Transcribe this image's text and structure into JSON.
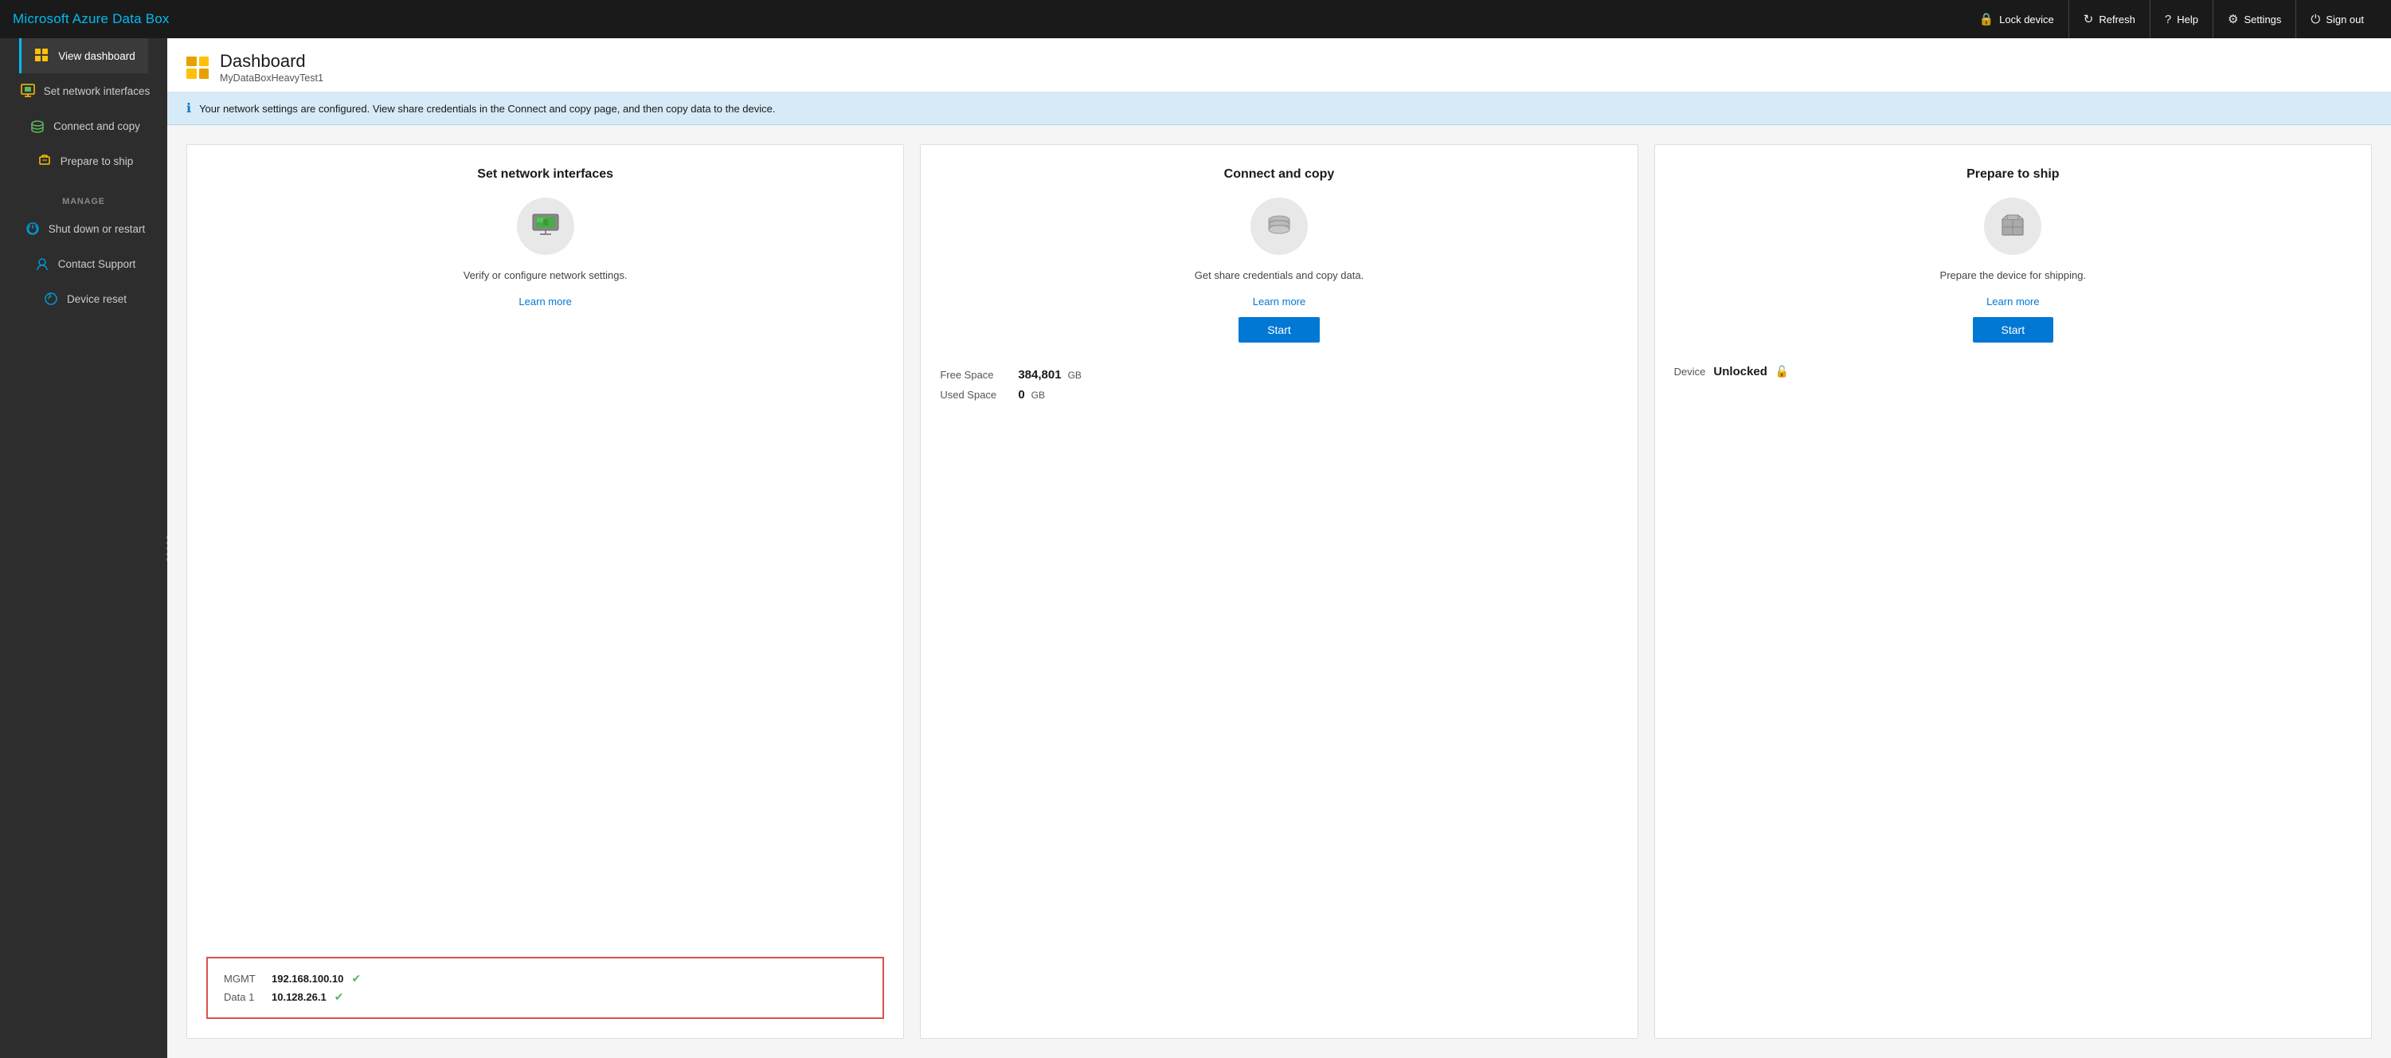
{
  "app": {
    "title": "Microsoft Azure Data Box"
  },
  "topbar": {
    "buttons": [
      {
        "id": "lock-device",
        "label": "Lock device",
        "icon": "🔒"
      },
      {
        "id": "refresh",
        "label": "Refresh",
        "icon": "↻"
      },
      {
        "id": "help",
        "label": "Help",
        "icon": "?"
      },
      {
        "id": "settings",
        "label": "Settings",
        "icon": "⚙"
      },
      {
        "id": "sign-out",
        "label": "Sign out",
        "icon": "⏻"
      }
    ]
  },
  "sidebar": {
    "items": [
      {
        "id": "view-dashboard",
        "label": "View dashboard",
        "active": true
      },
      {
        "id": "set-network-interfaces",
        "label": "Set network interfaces",
        "active": false
      },
      {
        "id": "connect-and-copy",
        "label": "Connect and copy",
        "active": false
      },
      {
        "id": "prepare-to-ship",
        "label": "Prepare to ship",
        "active": false
      }
    ],
    "manage_label": "MANAGE",
    "manage_items": [
      {
        "id": "shut-down-or-restart",
        "label": "Shut down or restart",
        "active": false
      },
      {
        "id": "contact-support",
        "label": "Contact Support",
        "active": false
      },
      {
        "id": "device-reset",
        "label": "Device reset",
        "active": false
      }
    ]
  },
  "header": {
    "title": "Dashboard",
    "subtitle": "MyDataBoxHeavyTest1"
  },
  "banner": {
    "message": "Your network settings are configured. View share credentials in the Connect and copy page, and then copy data to the device."
  },
  "cards": [
    {
      "id": "set-network-interfaces",
      "title": "Set network interfaces",
      "description": "Verify or configure network settings.",
      "learn_more": "Learn more",
      "has_start": false,
      "footer_type": "network",
      "network": {
        "rows": [
          {
            "label": "MGMT",
            "value": "192.168.100.10",
            "ok": true
          },
          {
            "label": "Data 1",
            "value": "10.128.26.1",
            "ok": true
          }
        ]
      }
    },
    {
      "id": "connect-and-copy",
      "title": "Connect and copy",
      "description": "Get share credentials and copy data.",
      "learn_more": "Learn more",
      "start_label": "Start",
      "has_start": true,
      "footer_type": "space",
      "space": {
        "rows": [
          {
            "label": "Free Space",
            "value": "384,801",
            "unit": "GB"
          },
          {
            "label": "Used Space",
            "value": "0",
            "unit": "GB"
          }
        ]
      }
    },
    {
      "id": "prepare-to-ship",
      "title": "Prepare to ship",
      "description": "Prepare the device for shipping.",
      "learn_more": "Learn more",
      "start_label": "Start",
      "has_start": true,
      "footer_type": "device",
      "device": {
        "label": "Device",
        "value": "Unlocked"
      }
    }
  ]
}
